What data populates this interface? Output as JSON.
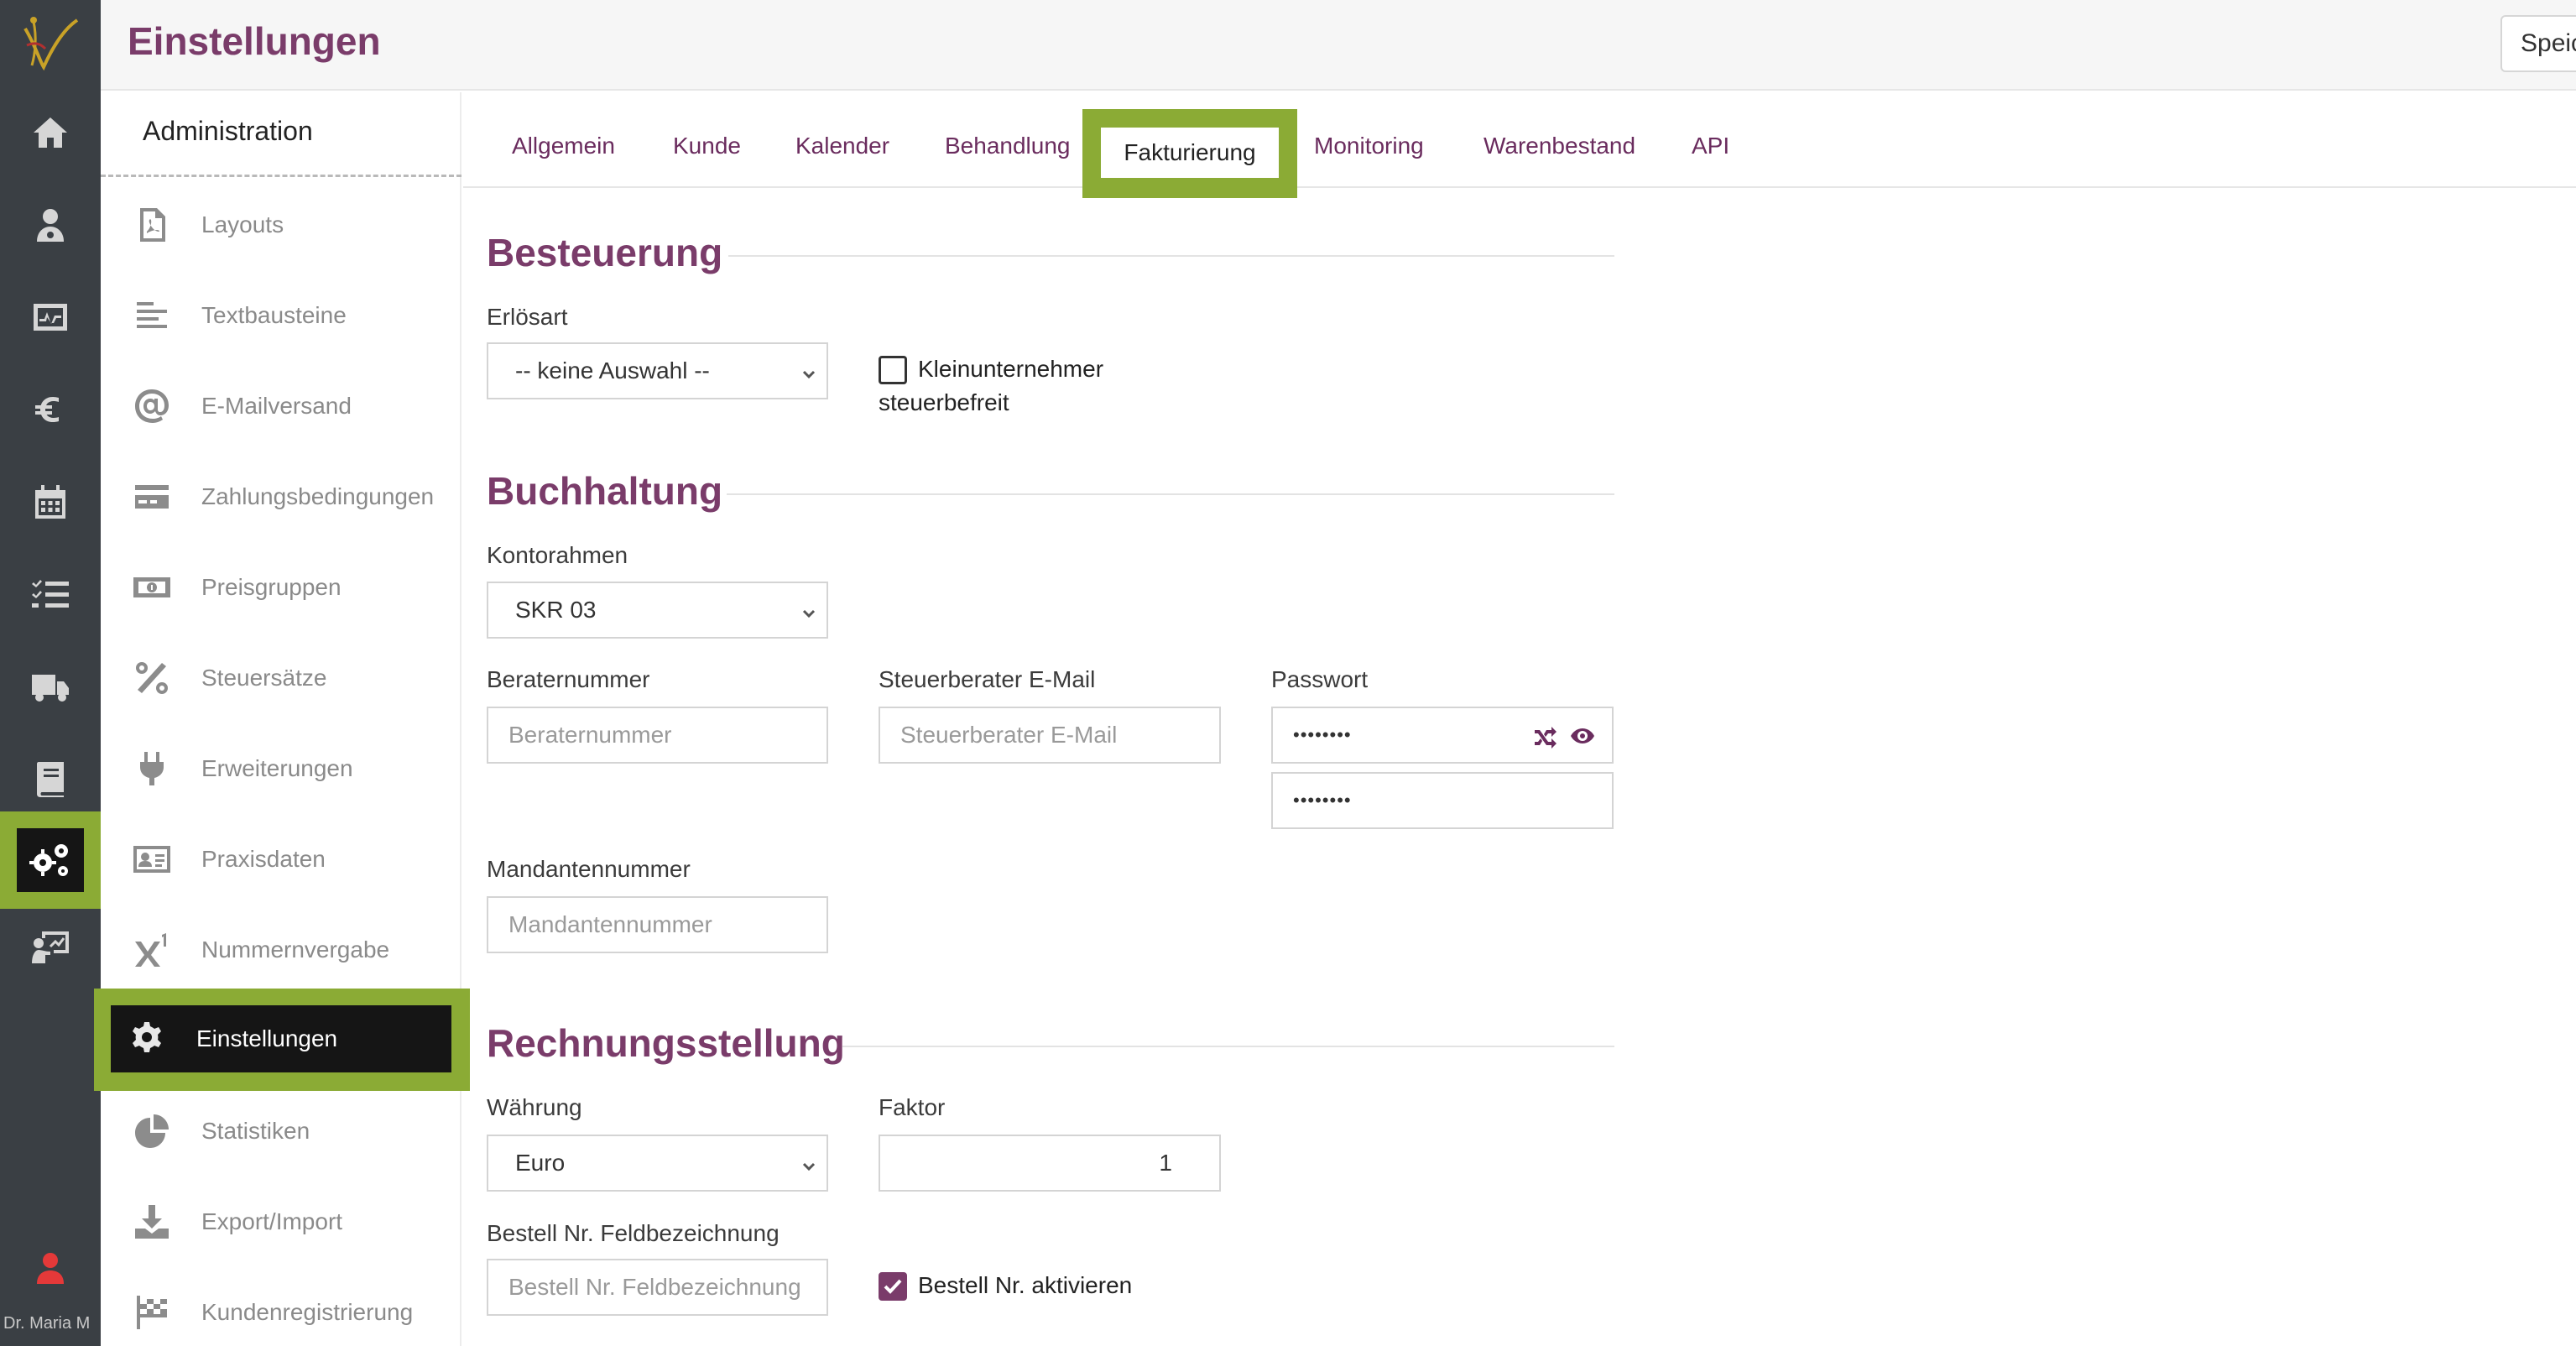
{
  "header": {
    "title": "Einstellungen",
    "save_label": "Speic"
  },
  "rail": {
    "user_name": "Dr. Maria M"
  },
  "subnav": {
    "title": "Administration",
    "items": [
      {
        "label": "Layouts",
        "icon": "pdf-file-icon"
      },
      {
        "label": "Textbausteine",
        "icon": "align-left-icon"
      },
      {
        "label": "E-Mailversand",
        "icon": "at-sign-icon"
      },
      {
        "label": "Zahlungsbedingungen",
        "icon": "credit-card-icon"
      },
      {
        "label": "Preisgruppen",
        "icon": "money-bill-icon"
      },
      {
        "label": "Steuersätze",
        "icon": "percent-icon"
      },
      {
        "label": "Erweiterungen",
        "icon": "plug-icon"
      },
      {
        "label": "Praxisdaten",
        "icon": "id-card-icon"
      },
      {
        "label": "Nummernvergabe",
        "icon": "superscript-icon"
      },
      {
        "label": "Einstellungen",
        "icon": "gear-icon"
      },
      {
        "label": "Statistiken",
        "icon": "pie-chart-icon"
      },
      {
        "label": "Export/Import",
        "icon": "download-icon"
      },
      {
        "label": "Kundenregistrierung",
        "icon": "checkered-flag-icon"
      }
    ]
  },
  "tabs": [
    "Allgemein",
    "Kunde",
    "Kalender",
    "Behandlung",
    "Fakturierung",
    "Monitoring",
    "Warenbestand",
    "API"
  ],
  "active_tab": "Fakturierung",
  "sections": {
    "besteuerung": {
      "title": "Besteuerung",
      "erloesart_label": "Erlösart",
      "erloesart_value": "-- keine Auswahl --",
      "kleinunternehmer_label": "Kleinunternehmer",
      "kleinunternehmer_sub": "steuerbefreit"
    },
    "buchhaltung": {
      "title": "Buchhaltung",
      "kontorahmen_label": "Kontorahmen",
      "kontorahmen_value": "SKR 03",
      "beraternummer_label": "Beraternummer",
      "beraternummer_placeholder": "Beraternummer",
      "steuerberater_label": "Steuerberater E-Mail",
      "steuerberater_placeholder": "Steuerberater E-Mail",
      "passwort_label": "Passwort",
      "passwort_value": "••••••••",
      "passwort_repeat_value": "••••••••",
      "mandantennummer_label": "Mandantennummer",
      "mandantennummer_placeholder": "Mandantennummer"
    },
    "rechnungsstellung": {
      "title": "Rechnungsstellung",
      "waehrung_label": "Währung",
      "waehrung_value": "Euro",
      "faktor_label": "Faktor",
      "faktor_value": "1",
      "bestellnr_label": "Bestell Nr. Feldbezeichnung",
      "bestellnr_placeholder": "Bestell Nr. Feldbezeichnung",
      "bestellnr_aktivieren_label": "Bestell Nr. aktivieren"
    }
  },
  "colors": {
    "accent": "#7a3c6a",
    "highlight": "#8bab35",
    "rail": "#3a3f44"
  }
}
